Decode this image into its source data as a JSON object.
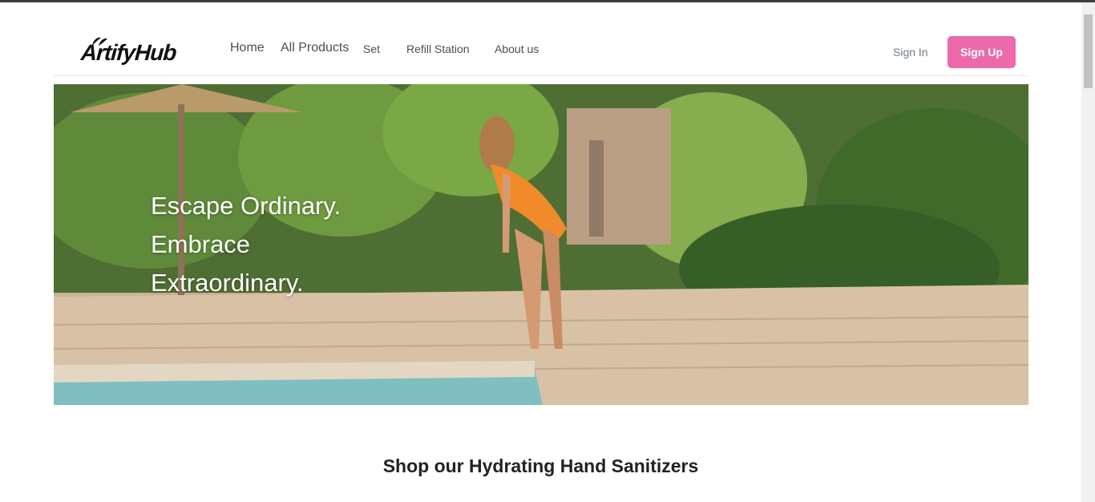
{
  "brand": {
    "name": "ArtifyHub"
  },
  "nav": {
    "items": [
      "Home",
      "All Products",
      "Set",
      "Refill Station",
      "About us"
    ]
  },
  "auth": {
    "sign_in": "Sign In",
    "sign_up": "Sign Up"
  },
  "hero": {
    "lines": [
      "Escape Ordinary.",
      "Embrace",
      "Extraordinary."
    ]
  },
  "section": {
    "title": "Shop our Hydrating Hand Sanitizers"
  },
  "colors": {
    "accent": "#ec6aa9",
    "nav_text": "#4a4f55",
    "signin_text": "#707a85"
  },
  "icons": {
    "logo_leaf": "leaf-icon"
  }
}
